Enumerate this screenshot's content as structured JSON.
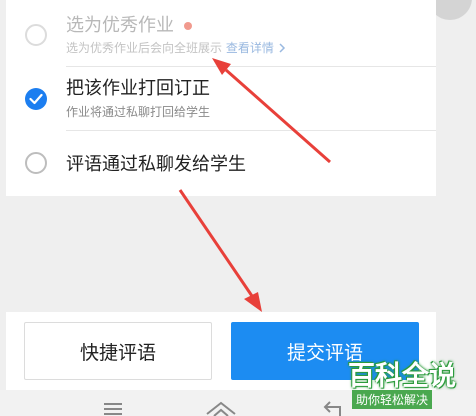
{
  "options": [
    {
      "title": "选为优秀作业",
      "subtitle": "选为优秀作业后会向全班展示",
      "link": "查看详情",
      "state": "disabled",
      "has_dot": true
    },
    {
      "title": "把该作业打回订正",
      "subtitle": "作业将通过私聊打回给学生",
      "state": "checked"
    },
    {
      "title": "评语通过私聊发给学生",
      "state": "unchecked"
    }
  ],
  "actions": {
    "quick_comment_label": "快捷评语",
    "submit_label": "提交评语"
  },
  "watermark": {
    "title": "百科全说",
    "subtitle": "助你轻松解决"
  },
  "colors": {
    "primary": "#1c8cf2",
    "annotation_arrow": "#e8403a"
  },
  "icons": [
    "checkmark-icon",
    "chevron-right-icon",
    "menu-icon",
    "home-icon",
    "back-icon"
  ]
}
